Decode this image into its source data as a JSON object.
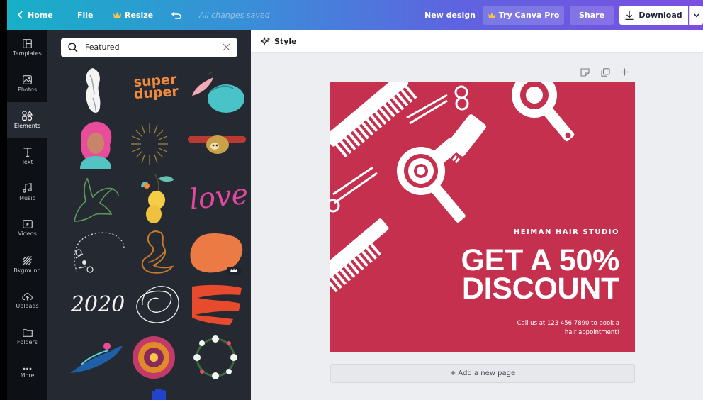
{
  "topbar": {
    "home": "Home",
    "file": "File",
    "resize": "Resize",
    "status": "All changes saved",
    "doc_title": "New design",
    "try_pro": "Try Canva Pro",
    "share": "Share",
    "download": "Download"
  },
  "rail": [
    {
      "label": "Templates",
      "icon": "templates-icon"
    },
    {
      "label": "Photos",
      "icon": "photos-icon"
    },
    {
      "label": "Elements",
      "icon": "elements-icon",
      "active": true
    },
    {
      "label": "Text",
      "icon": "text-icon"
    },
    {
      "label": "Music",
      "icon": "music-icon"
    },
    {
      "label": "Videos",
      "icon": "videos-icon"
    },
    {
      "label": "Bkground",
      "icon": "background-icon"
    },
    {
      "label": "Uploads",
      "icon": "uploads-icon"
    },
    {
      "label": "Folders",
      "icon": "folders-icon"
    },
    {
      "label": "More",
      "icon": "more-icon"
    }
  ],
  "panel": {
    "search_value": "Featured",
    "elements": [
      {
        "name": "white-figure-sketch"
      },
      {
        "name": "super-duper-text",
        "line1": "super",
        "line2": "duper"
      },
      {
        "name": "lemon-slice-illustration"
      },
      {
        "name": "pink-hair-woman-illustration"
      },
      {
        "name": "gold-starburst"
      },
      {
        "name": "sloth-on-branch"
      },
      {
        "name": "hand-line-drawing"
      },
      {
        "name": "lemon-branch-illustration"
      },
      {
        "name": "love-script-text",
        "text": "love"
      },
      {
        "name": "floral-wreath-sketch"
      },
      {
        "name": "cobra-illustration"
      },
      {
        "name": "orange-blob-shape",
        "pro": true
      },
      {
        "name": "2020-script-text",
        "text": "2020"
      },
      {
        "name": "scribble-circle"
      },
      {
        "name": "red-brush-stroke"
      },
      {
        "name": "hummingbird-illustration"
      },
      {
        "name": "mandala-ornament"
      },
      {
        "name": "daisy-wreath"
      }
    ]
  },
  "canvas": {
    "style_label": "Style",
    "studio": "HEIMAN HAIR STUDIO",
    "headline_line1": "GET A 50%",
    "headline_line2": "DISCOUNT",
    "callout_line1": "Call us at 123 456 7890 to book a",
    "callout_line2": "hair appointment!",
    "add_page": "+ Add a new page"
  },
  "colors": {
    "accent_gradient_start": "#17b0c7",
    "accent_gradient_end": "#7a4fe0",
    "design_background": "#c4304e",
    "panel_background": "#252a32",
    "rail_background": "#0d1116"
  }
}
